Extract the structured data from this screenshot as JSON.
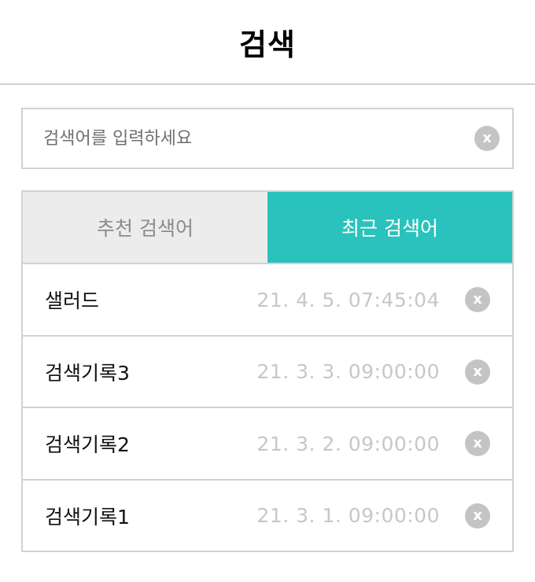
{
  "header": {
    "title": "검색"
  },
  "search": {
    "placeholder": "검색어를 입력하세요",
    "clear_label": "x"
  },
  "tabs": [
    {
      "label": "추천 검색어",
      "active": false
    },
    {
      "label": "최근 검색어",
      "active": true
    }
  ],
  "recent": [
    {
      "keyword": "샐러드",
      "time": "21. 4. 5. 07:45:04",
      "delete_label": "x"
    },
    {
      "keyword": "검색기록3",
      "time": "21. 3. 3. 09:00:00",
      "delete_label": "x"
    },
    {
      "keyword": "검색기록2",
      "time": "21. 3. 2. 09:00:00",
      "delete_label": "x"
    },
    {
      "keyword": "검색기록1",
      "time": "21. 3. 1. 09:00:00",
      "delete_label": "x"
    }
  ],
  "colors": {
    "accent": "#2ac2bc",
    "inactive_tab_bg": "#ececec",
    "border": "#d2d2d2",
    "clear_icon": "#c4c4c4"
  }
}
